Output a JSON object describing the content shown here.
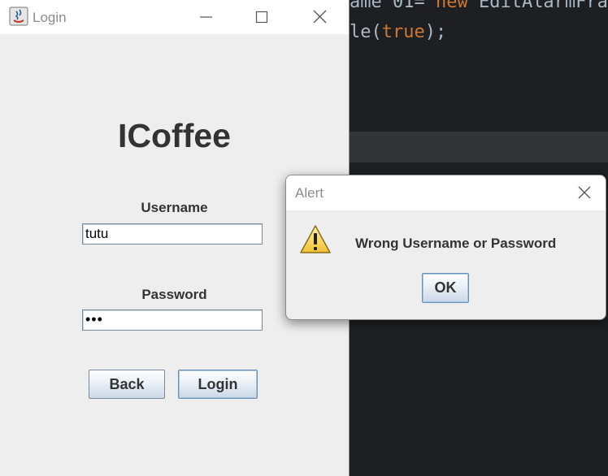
{
  "ide": {
    "line1_prefix": "ame 01= ",
    "line1_keyword": "new",
    "line1_suffix": " EditAlarmFra",
    "line2_prefix": "le(",
    "line2_keyword": "true",
    "line2_suffix": ");"
  },
  "login_window": {
    "title": "Login",
    "app_title": "ICoffee",
    "username_label": "Username",
    "username_value": "tutu",
    "password_label": "Password",
    "password_masked": "•••",
    "back_label": "Back",
    "login_label": "Login"
  },
  "alert_dialog": {
    "title": "Alert",
    "message": "Wrong Username or Password",
    "ok_label": "OK"
  },
  "colors": {
    "ide_background": "#1e1f22",
    "ide_keyword": "#cc7832",
    "window_background": "#eeeeee",
    "titlebar": "#ffffff"
  }
}
